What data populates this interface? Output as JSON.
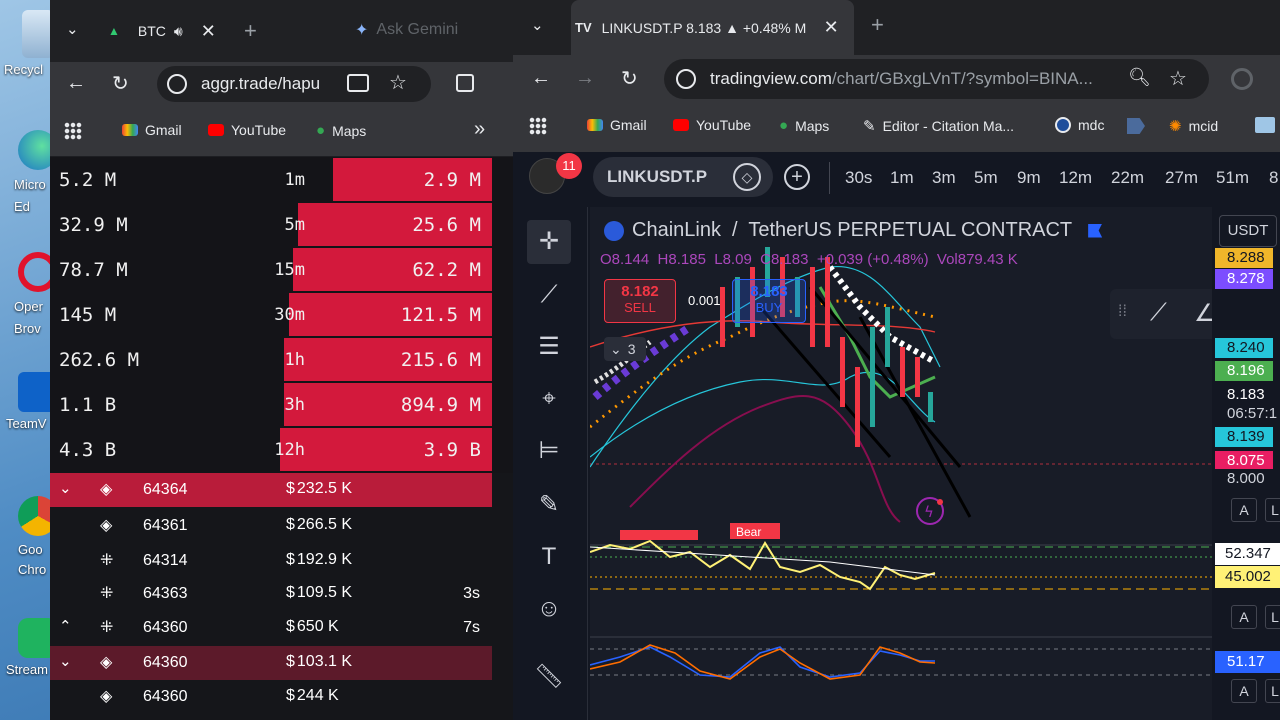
{
  "desktop": {
    "icons": [
      {
        "label": "Recycl"
      },
      {
        "label": "Micro Ed"
      },
      {
        "label": "Oper Brov"
      },
      {
        "label": "TeamV"
      },
      {
        "label": "Goo Chro"
      },
      {
        "label": "Stream"
      }
    ]
  },
  "left_browser": {
    "tab_title": "BTC",
    "ask_gemini": "Ask Gemini",
    "url": "aggr.trade/hapu",
    "bookmarks": [
      "Gmail",
      "YouTube",
      "Maps"
    ]
  },
  "stats": [
    {
      "volume": "5.2 M",
      "timeframe": "1m",
      "value": "2.9 M",
      "fill": 0.36
    },
    {
      "volume": "32.9 M",
      "timeframe": "5m",
      "value": "25.6 M",
      "fill": 0.44
    },
    {
      "volume": "78.7 M",
      "timeframe": "15m",
      "value": "62.2 M",
      "fill": 0.45
    },
    {
      "volume": "145 M",
      "timeframe": "30m",
      "value": "121.5 M",
      "fill": 0.46
    },
    {
      "volume": "262.6 M",
      "timeframe": "1h",
      "value": "215.6 M",
      "fill": 0.47
    },
    {
      "volume": "1.1 B",
      "timeframe": "3h",
      "value": "894.9 M",
      "fill": 0.47
    },
    {
      "volume": "4.3 B",
      "timeframe": "12h",
      "value": "3.9 B",
      "fill": 0.48
    }
  ],
  "trades": [
    {
      "chevron": "⌄",
      "price": "64364",
      "amount": "232.5 K",
      "age": "",
      "style": "hl",
      "exchange_icon": "diamond"
    },
    {
      "chevron": "",
      "price": "64361",
      "amount": "266.5 K",
      "age": "",
      "style": "",
      "exchange_icon": "diamond"
    },
    {
      "chevron": "",
      "price": "64314",
      "amount": "192.9 K",
      "age": "",
      "style": "",
      "exchange_icon": "x"
    },
    {
      "chevron": "",
      "price": "64363",
      "amount": "109.5 K",
      "age": "3s",
      "style": "",
      "exchange_icon": "x"
    },
    {
      "chevron": "⌃",
      "price": "64360",
      "amount": "650 K",
      "age": "7s",
      "style": "",
      "exchange_icon": "x"
    },
    {
      "chevron": "⌄",
      "price": "64360",
      "amount": "103.1 K",
      "age": "",
      "style": "hl2",
      "exchange_icon": "diamond"
    },
    {
      "chevron": "",
      "price": "64360",
      "amount": "244 K",
      "age": "",
      "style": "",
      "exchange_icon": "diamond"
    }
  ],
  "right_browser": {
    "tab_title": "LINKUSDT.P 8.183 ▲ +0.48% M",
    "url_host": "tradingview.com",
    "url_path": "/chart/GBxgLVnT/?symbol=BINA...",
    "bookmarks": [
      "Gmail",
      "YouTube",
      "Maps",
      "Editor - Citation Ma...",
      "mdc",
      "mcid"
    ]
  },
  "tradingview": {
    "badge": "11",
    "symbol": "LINKUSDT.P",
    "timeframes": [
      "30s",
      "1m",
      "3m",
      "5m",
      "9m",
      "12m",
      "22m",
      "27m",
      "51m",
      "8"
    ],
    "pair_title": "ChainLink  /  TetherUS PERPETUAL CONTRACT",
    "ohlc": "O8.144  H8.185  L8.09  C8.183  +0.039 (+0.48%)  Vol879.43 K",
    "sell_price": "8.182",
    "sell_label": "SELL",
    "spread": "0.001",
    "buy_price": "8.183",
    "buy_label": "BUY",
    "collapse_count": "3",
    "currency": "USDT",
    "bear_label": "Bear",
    "price_labels": [
      {
        "text": "8.288",
        "bg": "#f0b62a",
        "color": "#131722"
      },
      {
        "text": "8.278",
        "bg": "#7c4dff",
        "color": "#ffffff"
      },
      {
        "text": "8.240",
        "bg": "#26c6da",
        "color": "#131722"
      },
      {
        "text": "8.196",
        "bg": "#4caf50",
        "color": "#ffffff"
      },
      {
        "text": "8.183",
        "bg": "#131722",
        "color": "#ffffff"
      },
      {
        "text": "06:57:1",
        "bg": "#131722",
        "color": "#d1d4dc"
      },
      {
        "text": "8.139",
        "bg": "#26c6da",
        "color": "#131722"
      },
      {
        "text": "8.075",
        "bg": "#e91e63",
        "color": "#ffffff"
      },
      {
        "text": "8.000",
        "bg": "#131722",
        "color": "#d1d4dc"
      }
    ],
    "rsi_labels": [
      {
        "text": "52.347",
        "bg": "#ffffff",
        "color": "#131722"
      },
      {
        "text": "45.002",
        "bg": "#fff176",
        "color": "#131722"
      }
    ],
    "stoch_label": {
      "text": "51.17",
      "bg": "#2962ff",
      "color": "#ffffff"
    },
    "auto_btn": "A",
    "log_btn": "L"
  }
}
